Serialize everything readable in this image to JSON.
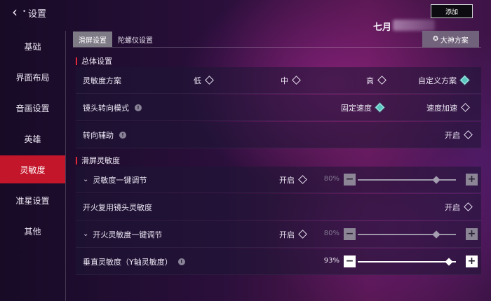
{
  "header": {
    "back_label": "‹",
    "separator": "•",
    "title": "设置",
    "player_name": "七月",
    "top_right_button": "添加"
  },
  "sidebar": {
    "items": [
      {
        "label": "基础",
        "active": false
      },
      {
        "label": "界面布局",
        "active": false
      },
      {
        "label": "音画设置",
        "active": false
      },
      {
        "label": "英雄",
        "active": false
      },
      {
        "label": "灵敏度",
        "active": true
      },
      {
        "label": "准星设置",
        "active": false
      },
      {
        "label": "其他",
        "active": false
      }
    ]
  },
  "tabs": [
    {
      "label": "滑屏设置",
      "active": true
    },
    {
      "label": "陀螺仪设置",
      "active": false
    }
  ],
  "dashen_button": {
    "icon": "✪",
    "label": "大神方案"
  },
  "sections": {
    "general": {
      "title": "总体设置",
      "rows": {
        "sensitivity_plan": {
          "label": "灵敏度方案",
          "options": [
            "低",
            "中",
            "高",
            "自定义方案"
          ],
          "selected": "自定义方案"
        },
        "camera_mode": {
          "label": "镜头转向模式",
          "info": "!",
          "options": [
            "固定速度",
            "速度加速"
          ],
          "selected": "固定速度"
        },
        "turn_assist": {
          "label": "转向辅助",
          "info": "!",
          "toggle_label": "开启"
        }
      }
    },
    "swipe": {
      "title": "滑屏灵敏度",
      "rows": {
        "one_key": {
          "chevron": "⌄",
          "label": "灵敏度一键调节",
          "toggle_label": "开启",
          "percent": "80%",
          "value": 0.8
        },
        "fire_reuse": {
          "label": "开火复用镜头灵敏度",
          "toggle_label": "开启"
        },
        "fire_one_key": {
          "chevron": "⌄",
          "label": "开火灵敏度一键调节",
          "toggle_label": "开启",
          "percent": "80%",
          "value": 0.8
        },
        "vertical": {
          "label": "垂直灵敏度（Y轴灵敏度）",
          "info": "!",
          "percent": "93%",
          "value": 0.93
        }
      }
    }
  },
  "slider": {
    "minus": "−",
    "plus": "+"
  }
}
